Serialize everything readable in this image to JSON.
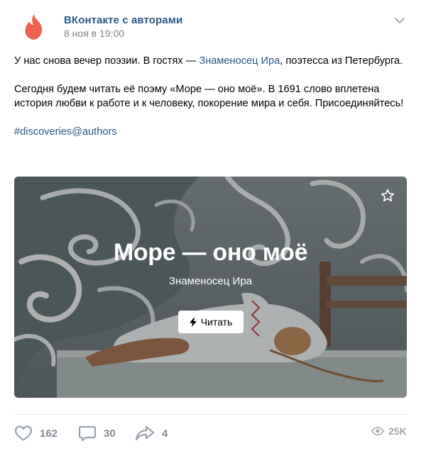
{
  "post": {
    "author": "ВКонтакте с авторами",
    "date": "8 ноя в 19:00",
    "text": {
      "line1_before": "У нас снова вечер поэзии. В гостях — ",
      "author_link": "Знаменосец Ира",
      "line1_after": ", поэтесса из Петербурга.",
      "paragraph2": "Сегодня будем читать её поэму «Море — оно моё». В 1691 слово вплетена история любви к работе и к человеку, покорение мира и себя. Присоединяйтесь!",
      "hashtag": "#discoveries@authors"
    },
    "card": {
      "title": "Море — оно моё",
      "subtitle": "Знаменосец Ира",
      "read_button": "Читать"
    },
    "actions": {
      "likes": "162",
      "comments": "30",
      "shares": "4",
      "views": "25K"
    },
    "icons": {
      "avatar": "tinder-flame-icon",
      "menu": "chevron-down-icon",
      "bookmark": "star-icon",
      "read": "lightning-icon",
      "like": "heart-icon",
      "comment": "comment-icon",
      "share": "share-arrow-icon",
      "views": "eye-icon"
    },
    "colors": {
      "link": "#2a5885",
      "secondary": "#828282",
      "action": "#828a99",
      "avatar": "#f0614f"
    }
  }
}
